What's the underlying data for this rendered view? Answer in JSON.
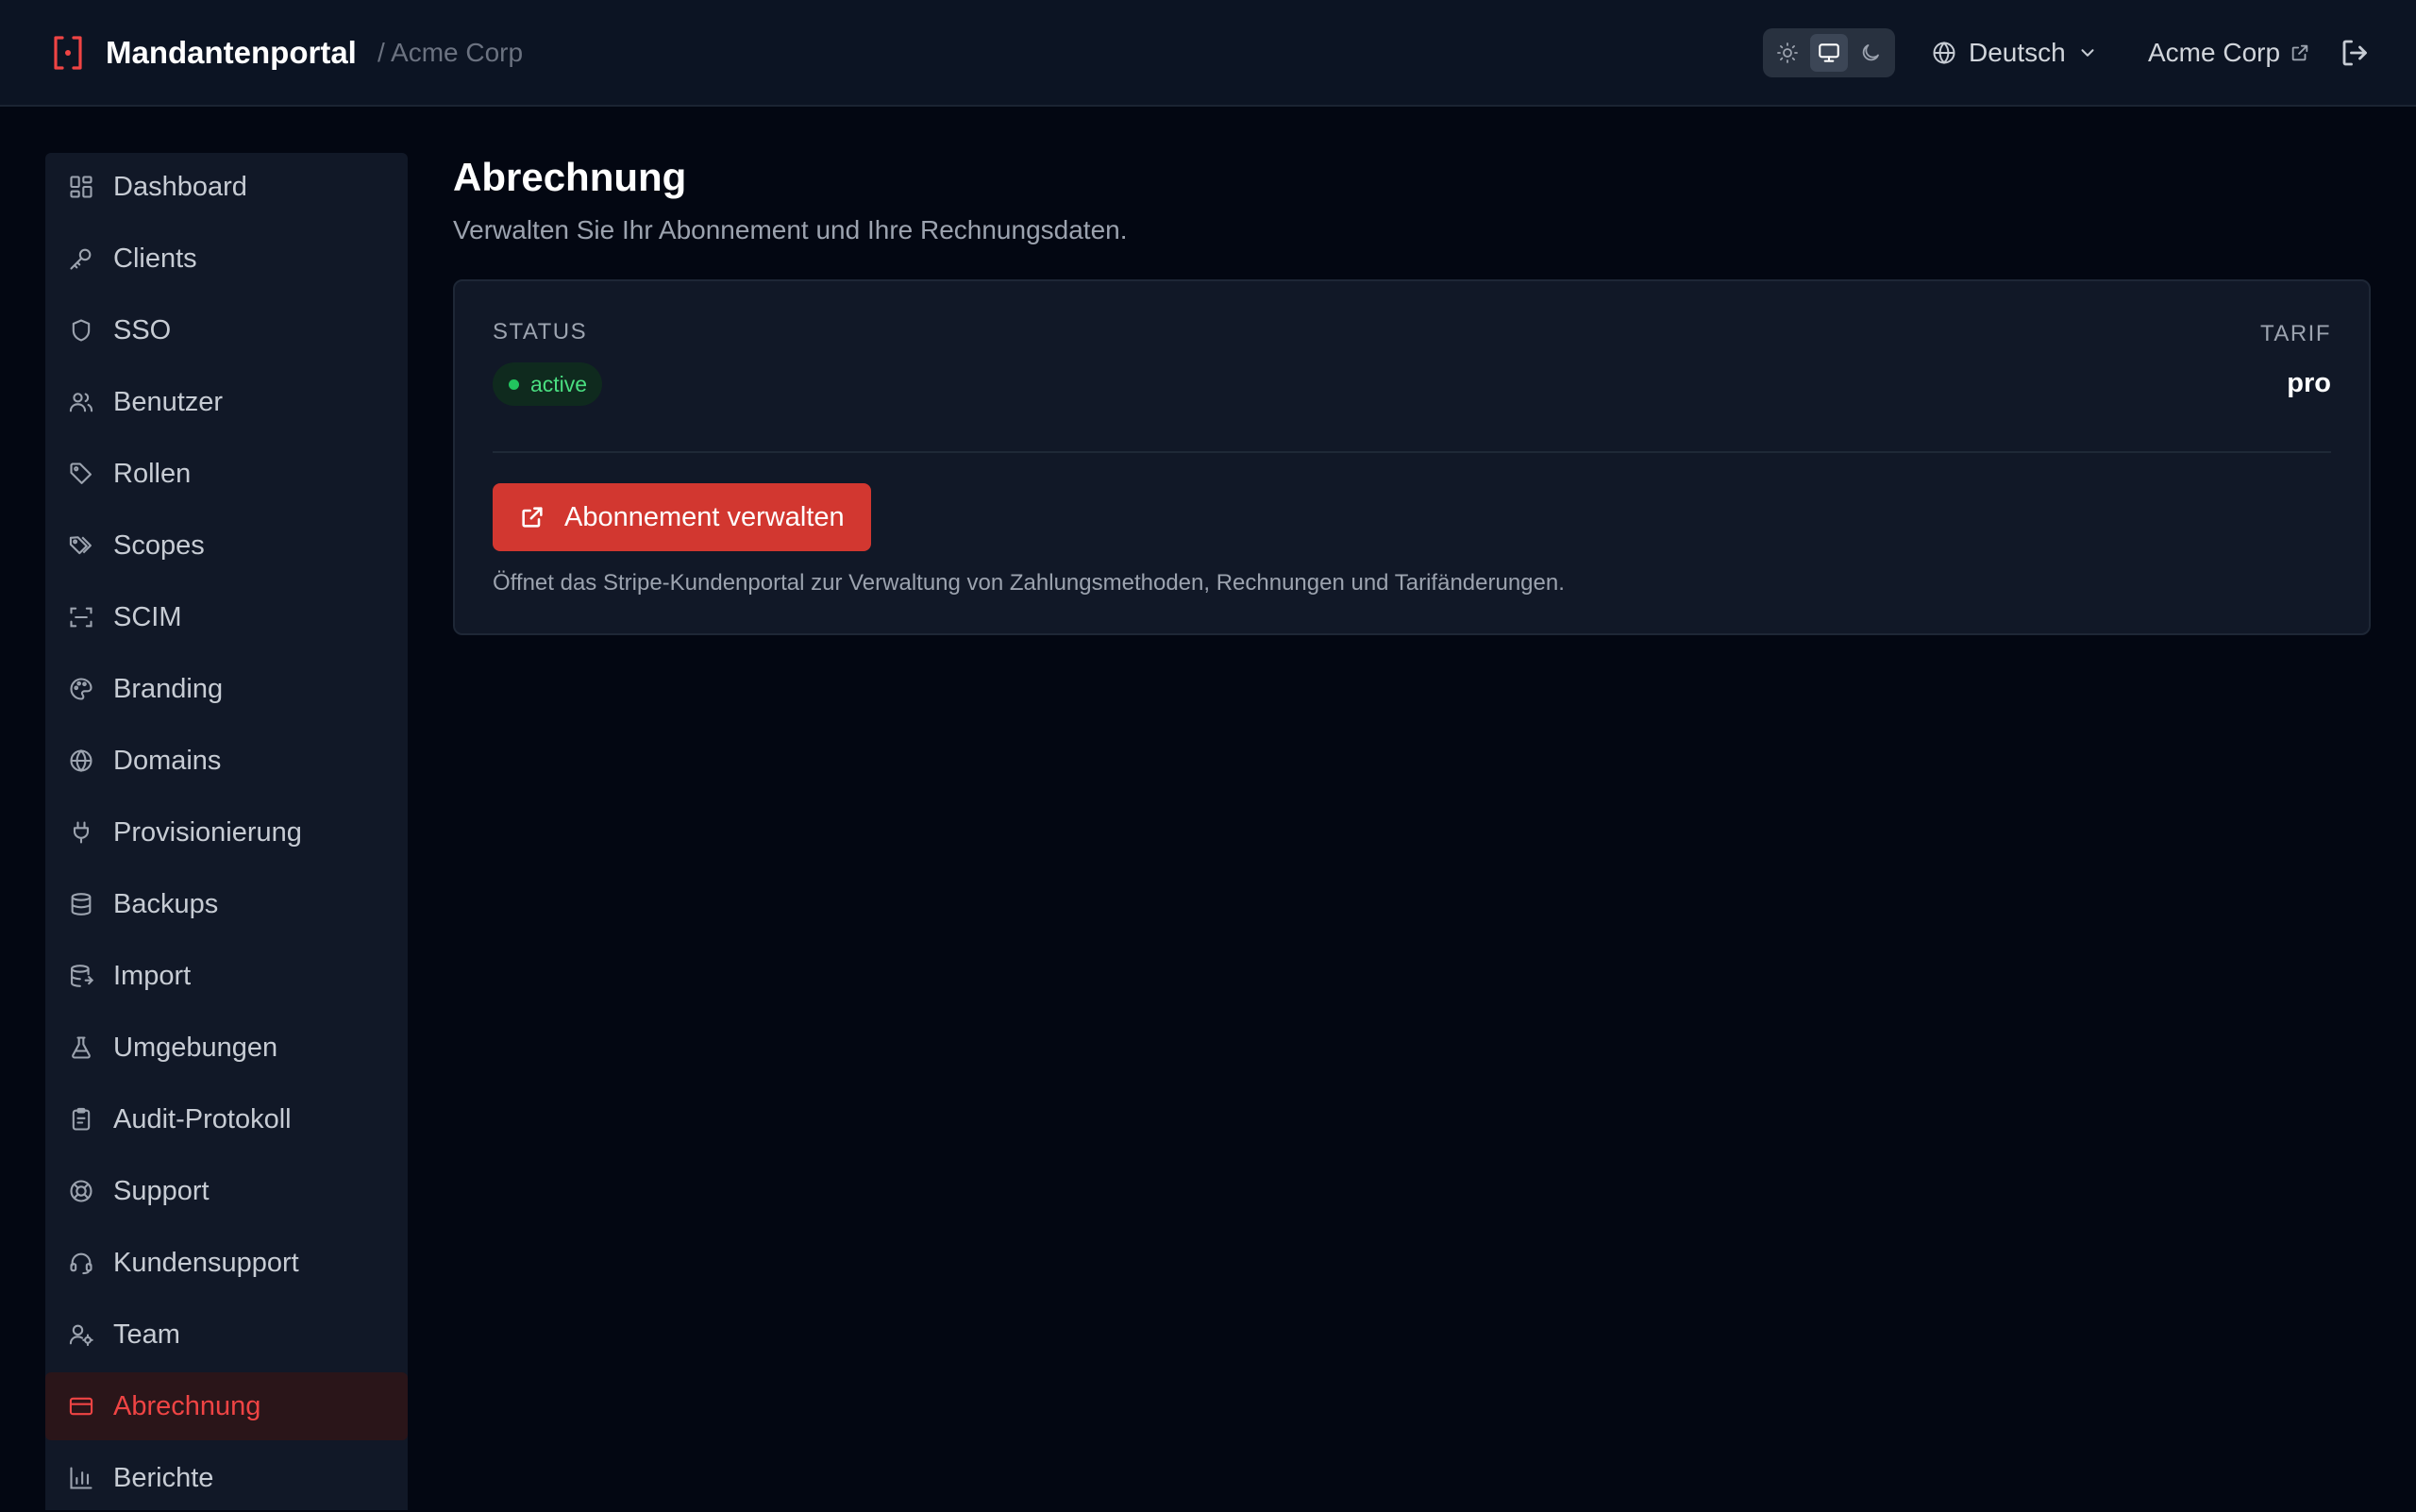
{
  "header": {
    "brand_title": "Mandantenportal",
    "brand_crumb": "/ Acme Corp",
    "theme_options": [
      "light",
      "system",
      "dark"
    ],
    "theme_selected": "system",
    "language": "Deutsch",
    "tenant_name": "Acme Corp"
  },
  "sidebar": {
    "items": [
      {
        "label": "Dashboard",
        "icon": "dashboard-icon"
      },
      {
        "label": "Clients",
        "icon": "key-icon"
      },
      {
        "label": "SSO",
        "icon": "shield-icon"
      },
      {
        "label": "Benutzer",
        "icon": "users-icon"
      },
      {
        "label": "Rollen",
        "icon": "tag-icon"
      },
      {
        "label": "Scopes",
        "icon": "tags-icon"
      },
      {
        "label": "SCIM",
        "icon": "scan-icon"
      },
      {
        "label": "Branding",
        "icon": "palette-icon"
      },
      {
        "label": "Domains",
        "icon": "globe-icon"
      },
      {
        "label": "Provisionierung",
        "icon": "plug-icon"
      },
      {
        "label": "Backups",
        "icon": "database-icon"
      },
      {
        "label": "Import",
        "icon": "database-import-icon"
      },
      {
        "label": "Umgebungen",
        "icon": "flask-icon"
      },
      {
        "label": "Audit-Protokoll",
        "icon": "clipboard-icon"
      },
      {
        "label": "Support",
        "icon": "lifebuoy-icon"
      },
      {
        "label": "Kundensupport",
        "icon": "headset-icon"
      },
      {
        "label": "Team",
        "icon": "user-cog-icon"
      },
      {
        "label": "Abrechnung",
        "icon": "credit-card-icon",
        "active": true
      },
      {
        "label": "Berichte",
        "icon": "bar-chart-icon"
      }
    ]
  },
  "main": {
    "title": "Abrechnung",
    "subtitle": "Verwalten Sie Ihr Abonnement und Ihre Rechnungsdaten.",
    "status_label": "STATUS",
    "status_value": "active",
    "tarif_label": "TARIF",
    "tarif_value": "pro",
    "manage_button": "Abonnement verwalten",
    "hint": "Öffnet das Stripe-Kundenportal zur Verwaltung von Zahlungsmethoden, Rechnungen und Tarifänderungen."
  },
  "colors": {
    "accent": "#d23730",
    "active_nav_text": "#ef4444",
    "status_green": "#22c55e",
    "background": "#030712",
    "surface": "#111827"
  }
}
